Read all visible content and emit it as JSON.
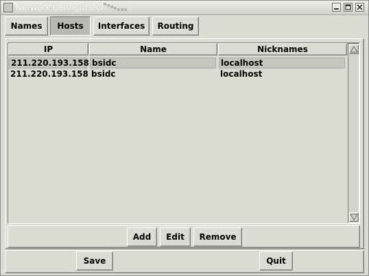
{
  "window": {
    "title": "Network Configurator",
    "minimize_icon": "minimize-icon",
    "maximize_icon": "maximize-icon",
    "close_icon": "close-icon"
  },
  "tabs": [
    {
      "label": "Names",
      "active": false
    },
    {
      "label": "Hosts",
      "active": true
    },
    {
      "label": "Interfaces",
      "active": false
    },
    {
      "label": "Routing",
      "active": false
    }
  ],
  "hosts_table": {
    "columns": [
      "IP",
      "Name",
      "Nicknames"
    ],
    "rows": [
      {
        "ip": "211.220.193.158",
        "name": "bsidc",
        "nicknames": "localhost",
        "selected": true
      },
      {
        "ip": "211.220.193.158",
        "name": "bsidc",
        "nicknames": "localhost",
        "selected": false
      }
    ]
  },
  "list_actions": {
    "add_label": "Add",
    "edit_label": "Edit",
    "remove_label": "Remove"
  },
  "dialog_actions": {
    "save_label": "Save",
    "quit_label": "Quit"
  }
}
